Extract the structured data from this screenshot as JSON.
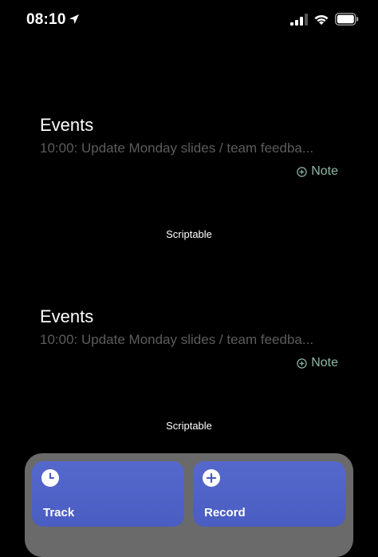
{
  "status_bar": {
    "time": "08:10"
  },
  "widgets": [
    {
      "title": "Events",
      "event": "10:00: Update Monday slides / team feedba...",
      "note_label": "Note",
      "app_label": "Scriptable"
    },
    {
      "title": "Events",
      "event": "10:00: Update Monday slides / team feedba...",
      "note_label": "Note",
      "app_label": "Scriptable"
    }
  ],
  "shortcuts": {
    "track_label": "Track",
    "record_label": "Record"
  },
  "colors": {
    "background": "#000000",
    "event_text": "#5c5c5c",
    "note_accent": "#8fb8a8",
    "tile_blue": "#5568cc",
    "shortcuts_bg": "#6a6a6a"
  }
}
